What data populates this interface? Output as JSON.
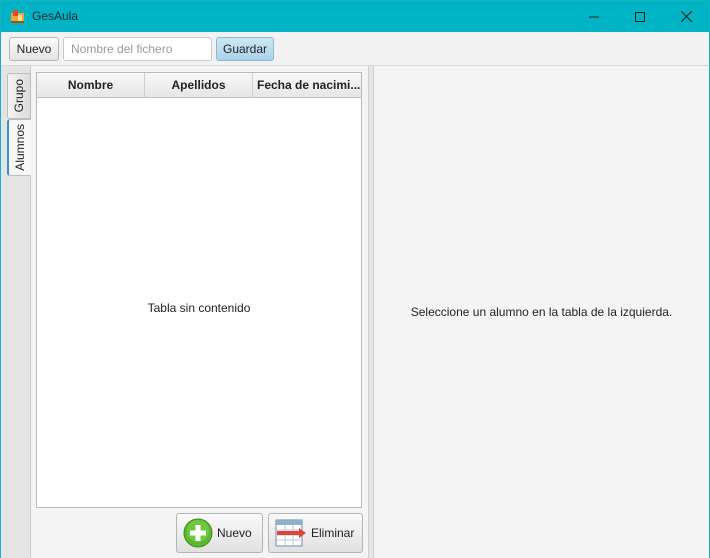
{
  "window": {
    "title": "GesAula",
    "accent_color": "#00b4c5",
    "controls": {
      "minimize_icon": "minimize-icon",
      "maximize_icon": "maximize-icon",
      "close_icon": "close-icon"
    }
  },
  "toolbar": {
    "new_label": "Nuevo",
    "filename_placeholder": "Nombre del fichero",
    "filename_value": "",
    "save_label": "Guardar"
  },
  "tabs": [
    {
      "label": "Grupo",
      "active": false
    },
    {
      "label": "Alumnos",
      "active": true
    }
  ],
  "students_table": {
    "columns": [
      "Nombre",
      "Apellidos",
      "Fecha de nacimi..."
    ],
    "rows": [],
    "empty_text": "Tabla sin contenido"
  },
  "actions": {
    "new_label": "Nuevo",
    "new_icon": "add-circle-icon",
    "delete_label": "Eliminar",
    "delete_icon": "delete-row-icon"
  },
  "detail": {
    "placeholder_text": "Seleccione un alumno en la tabla de la izquierda."
  }
}
